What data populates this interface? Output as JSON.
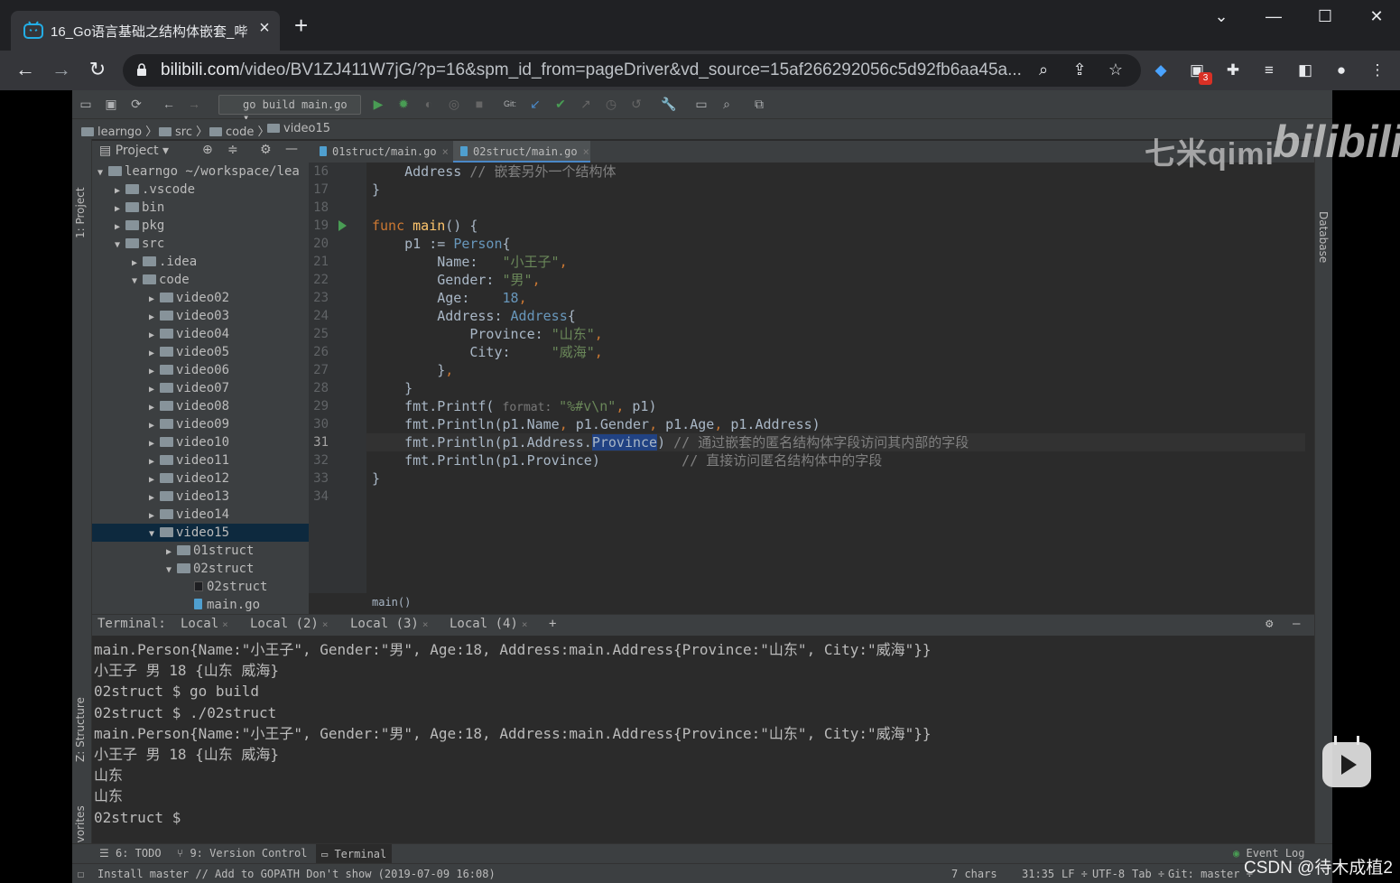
{
  "browser": {
    "tab_title": "16_Go语言基础之结构体嵌套_哔",
    "url_host": "bilibili.com",
    "url_rest": "/video/BV1ZJ411W7jG/?p=16&spm_id_from=pageDriver&vd_source=15af266292056c5d92fb6aa45a...",
    "extension_badge": "3"
  },
  "ide": {
    "run_config": "go build main.go",
    "breadcrumbs": [
      "learngo",
      "src",
      "code",
      "video15"
    ],
    "project_header": "Project",
    "side_tabs": {
      "project": "1: Project",
      "structure": "Z: Structure",
      "favorites": "2: Favorites",
      "database": "Database"
    },
    "tree": [
      {
        "label": "learngo  ~/workspace/lea",
        "kind": "folder",
        "depth": 0,
        "arrow": "▼"
      },
      {
        "label": ".vscode",
        "kind": "folder",
        "depth": 1,
        "arrow": "▶"
      },
      {
        "label": "bin",
        "kind": "folder",
        "depth": 1,
        "arrow": "▶"
      },
      {
        "label": "pkg",
        "kind": "folder",
        "depth": 1,
        "arrow": "▶"
      },
      {
        "label": "src",
        "kind": "folder",
        "depth": 1,
        "arrow": "▼"
      },
      {
        "label": ".idea",
        "kind": "folder",
        "depth": 2,
        "arrow": "▶"
      },
      {
        "label": "code",
        "kind": "folder",
        "depth": 2,
        "arrow": "▼"
      },
      {
        "label": "video02",
        "kind": "folder",
        "depth": 3,
        "arrow": "▶"
      },
      {
        "label": "video03",
        "kind": "folder",
        "depth": 3,
        "arrow": "▶"
      },
      {
        "label": "video04",
        "kind": "folder",
        "depth": 3,
        "arrow": "▶"
      },
      {
        "label": "video05",
        "kind": "folder",
        "depth": 3,
        "arrow": "▶"
      },
      {
        "label": "video06",
        "kind": "folder",
        "depth": 3,
        "arrow": "▶"
      },
      {
        "label": "video07",
        "kind": "folder",
        "depth": 3,
        "arrow": "▶"
      },
      {
        "label": "video08",
        "kind": "folder",
        "depth": 3,
        "arrow": "▶"
      },
      {
        "label": "video09",
        "kind": "folder",
        "depth": 3,
        "arrow": "▶"
      },
      {
        "label": "video10",
        "kind": "folder",
        "depth": 3,
        "arrow": "▶"
      },
      {
        "label": "video11",
        "kind": "folder",
        "depth": 3,
        "arrow": "▶"
      },
      {
        "label": "video12",
        "kind": "folder",
        "depth": 3,
        "arrow": "▶"
      },
      {
        "label": "video13",
        "kind": "folder",
        "depth": 3,
        "arrow": "▶"
      },
      {
        "label": "video14",
        "kind": "folder",
        "depth": 3,
        "arrow": "▶"
      },
      {
        "label": "video15",
        "kind": "folder",
        "depth": 3,
        "arrow": "▼",
        "selected": true
      },
      {
        "label": "01struct",
        "kind": "folder",
        "depth": 4,
        "arrow": "▶"
      },
      {
        "label": "02struct",
        "kind": "folder",
        "depth": 4,
        "arrow": "▼"
      },
      {
        "label": "02struct",
        "kind": "binary",
        "depth": 5,
        "arrow": ""
      },
      {
        "label": "main.go",
        "kind": "gofile",
        "depth": 5,
        "arrow": ""
      }
    ],
    "editor_tabs": [
      {
        "label": "01struct/main.go",
        "active": false
      },
      {
        "label": "02struct/main.go",
        "active": true
      }
    ],
    "line_numbers": [
      "16",
      "17",
      "18",
      "19",
      "20",
      "21",
      "22",
      "23",
      "24",
      "25",
      "26",
      "27",
      "28",
      "29",
      "30",
      "31",
      "32",
      "33",
      "34"
    ],
    "current_line": "31",
    "code_lines": [
      [
        [
          "field",
          "    Address "
        ],
        [
          "cmt",
          "// 嵌套另外一个结构体"
        ]
      ],
      [
        [
          "plain",
          "}"
        ]
      ],
      [
        [
          "plain",
          ""
        ]
      ],
      [
        [
          "kw",
          "func "
        ],
        [
          "fn",
          "main"
        ],
        [
          "plain",
          "() {"
        ]
      ],
      [
        [
          "plain",
          "    p1 := "
        ],
        [
          "ty",
          "Person"
        ],
        [
          "plain",
          "{"
        ]
      ],
      [
        [
          "plain",
          "        Name:   "
        ],
        [
          "str",
          "\"小王子\""
        ],
        [
          "kw",
          ","
        ]
      ],
      [
        [
          "plain",
          "        Gender: "
        ],
        [
          "str",
          "\"男\""
        ],
        [
          "kw",
          ","
        ]
      ],
      [
        [
          "plain",
          "        Age:    "
        ],
        [
          "num",
          "18"
        ],
        [
          "kw",
          ","
        ]
      ],
      [
        [
          "plain",
          "        Address: "
        ],
        [
          "ty",
          "Address"
        ],
        [
          "plain",
          "{"
        ]
      ],
      [
        [
          "plain",
          "            Province: "
        ],
        [
          "str",
          "\"山东\""
        ],
        [
          "kw",
          ","
        ]
      ],
      [
        [
          "plain",
          "            City:     "
        ],
        [
          "str",
          "\"威海\""
        ],
        [
          "kw",
          ","
        ]
      ],
      [
        [
          "plain",
          "        }"
        ],
        [
          "kw",
          ","
        ]
      ],
      [
        [
          "plain",
          "    }"
        ]
      ],
      [
        [
          "plain",
          "    fmt.Printf( "
        ],
        [
          "hint",
          "format: "
        ],
        [
          "str",
          "\"%#v\\n\""
        ],
        [
          "kw",
          ", "
        ],
        [
          "plain",
          "p1)"
        ]
      ],
      [
        [
          "plain",
          "    fmt.Println(p1.Name"
        ],
        [
          "kw",
          ", "
        ],
        [
          "plain",
          "p1.Gender"
        ],
        [
          "kw",
          ", "
        ],
        [
          "plain",
          "p1.Age"
        ],
        [
          "kw",
          ", "
        ],
        [
          "plain",
          "p1.Address)"
        ]
      ],
      [
        [
          "plain",
          "    fmt.Println(p1.Address."
        ],
        [
          "sel",
          "Province"
        ],
        [
          "plain",
          ") "
        ],
        [
          "cmt",
          "// 通过嵌套的匿名结构体字段访问其内部的字段"
        ]
      ],
      [
        [
          "plain",
          "    fmt.Println(p1.Province)          "
        ],
        [
          "cmt",
          "// 直接访问匿名结构体中的字段"
        ]
      ],
      [
        [
          "plain",
          "}"
        ]
      ],
      [
        [
          "plain",
          ""
        ]
      ]
    ],
    "editor_breadcrumb": "main()",
    "terminal_tabs": [
      "Terminal:",
      "Local",
      "Local (2)",
      "Local (3)",
      "Local (4)"
    ],
    "terminal_lines": [
      "main.Person{Name:\"小王子\", Gender:\"男\", Age:18, Address:main.Address{Province:\"山东\", City:\"威海\"}}",
      "小王子 男 18 {山东 威海}",
      "02struct $ go build",
      "02struct $ ./02struct",
      "main.Person{Name:\"小王子\", Gender:\"男\", Age:18, Address:main.Address{Province:\"山东\", City:\"威海\"}}",
      "小王子 男 18 {山东 威海}",
      "山东",
      "山东",
      "02struct $"
    ],
    "bottom_tools": [
      "6: TODO",
      "9: Version Control",
      "Terminal",
      "Event Log"
    ],
    "status_message": "Install master // Add to GOPATH Don't show (2019-07-09 16:08)",
    "status_right": [
      "7 chars",
      "31:35",
      "LF ÷",
      "UTF-8",
      "Tab ÷",
      "Git: master ÷"
    ]
  },
  "overlays": {
    "watermark_qimi": "七米qimi",
    "watermark_bili": "bilibili",
    "csdn": "CSDN @待木成植2"
  }
}
